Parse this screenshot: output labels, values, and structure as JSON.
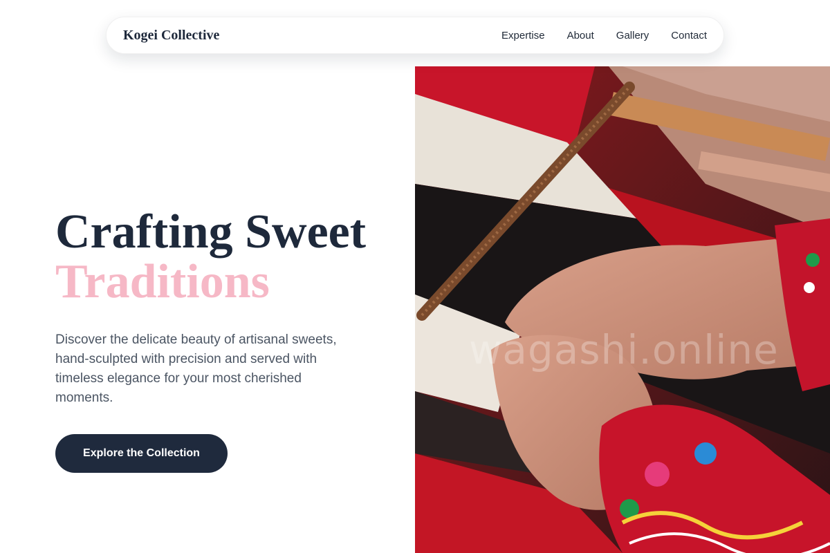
{
  "nav": {
    "brand": "Kogei Collective",
    "links": [
      {
        "label": "Expertise"
      },
      {
        "label": "About"
      },
      {
        "label": "Gallery"
      },
      {
        "label": "Contact"
      }
    ]
  },
  "hero": {
    "title_line1": "Crafting Sweet",
    "title_line2": "Traditions",
    "description": "Discover the delicate beauty of artisanal sweets, hand-sculpted with precision and served with timeless elegance for your most cherished moments.",
    "cta_label": "Explore the Collection"
  },
  "image": {
    "alt": "Hands weaving colorful threads on a loom",
    "watermark": "wagashi.online"
  },
  "colors": {
    "primary_dark": "#1e293b",
    "accent_pink": "#f6b8c6",
    "body_text": "#4b5563",
    "button_bg": "#1f2a3d"
  }
}
